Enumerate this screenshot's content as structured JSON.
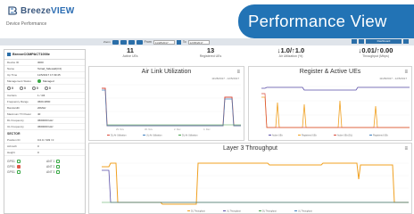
{
  "brand": {
    "name_prefix": "Breeze",
    "name_suffix": "VIEW",
    "page_subtitle": "Device Performance"
  },
  "banner": {
    "title": "Performance View"
  },
  "toolbar": {
    "from_label": "From",
    "from_value": "11/28/2017",
    "to_label": "To",
    "to_value": "12/05/2017",
    "right_button": "Dashboard"
  },
  "sidebar": {
    "device_name": "BreezeCOMPACT1000e",
    "rows": [
      {
        "k": "Device ID",
        "v": "3000"
      },
      {
        "k": "Name",
        "v": "Telrad_Sidewall(3.0)"
      },
      {
        "k": "Up Time",
        "v": "11/5/2017 17:39:45"
      },
      {
        "k": "Management Status",
        "v": "Managed"
      }
    ],
    "counts": [
      "0",
      "0",
      "0",
      "0"
    ],
    "details": [
      {
        "k": "Carriers",
        "v": "1 / 4/4"
      },
      {
        "k": "Frequency Range",
        "v": "3600-3800"
      },
      {
        "k": "Bandwidth",
        "v": "20MHz"
      },
      {
        "k": "Maximum TX Power",
        "v": "40"
      },
      {
        "k": "DL Frequency",
        "v": "3660000 kHz"
      },
      {
        "k": "UL Frequency",
        "v": "3660000 kHz"
      }
    ],
    "sector_title": "SECTOR",
    "sector_rows": [
      {
        "k": "Position ID",
        "v": "0.0.0 / 333 / 0"
      },
      {
        "k": "Azimuth",
        "v": "0"
      },
      {
        "k": "Height",
        "v": "0"
      }
    ],
    "antennas": [
      {
        "a": "GPS1",
        "b": "ANT 1"
      },
      {
        "a": "GPS1",
        "b": "ANT 2"
      },
      {
        "a": "GPS1",
        "b": "ANT 3"
      }
    ]
  },
  "stats": [
    {
      "value": "11",
      "label": "Active UEs"
    },
    {
      "value": "13",
      "label": "Registered UEs"
    },
    {
      "value": "↓1.0/↑1.0",
      "label": "Air Utilization (%)"
    },
    {
      "value": "↓0.01/↑0.00",
      "label": "Throughput (Mbps)"
    }
  ],
  "charts": {
    "air_link": {
      "title": "Air Link Utilization",
      "menu": "≡",
      "date": "11/28/2017 - 12/5/2017"
    },
    "register": {
      "title": "Register & Active UEs",
      "menu": "≡",
      "date": "11/28/2017 - 12/5/2017"
    },
    "layer3": {
      "title": "Layer 3 Throughput",
      "menu": "≡"
    }
  },
  "colors": {
    "accent": "#2273b5",
    "brand_dark": "#3d5a80",
    "ok": "#39a845",
    "alert": "#e05a4a"
  }
}
